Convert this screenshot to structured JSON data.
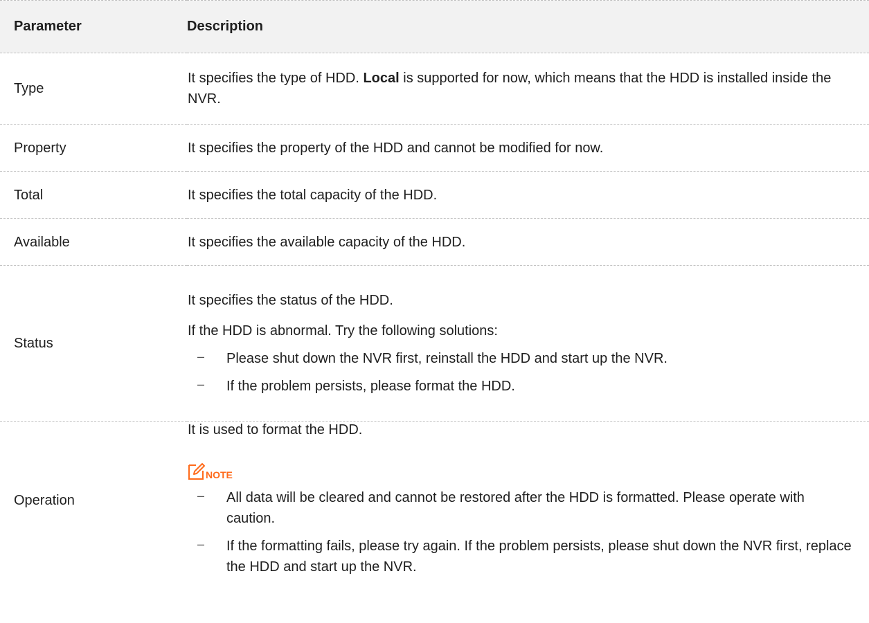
{
  "table": {
    "headers": {
      "parameter": "Parameter",
      "description": "Description"
    },
    "rows": {
      "type": {
        "name": "Type",
        "desc_before": "It specifies the type of HDD. ",
        "desc_bold": "Local",
        "desc_after": " is supported for now, which means that the HDD is installed inside the NVR."
      },
      "property": {
        "name": "Property",
        "desc": "It specifies the property of the HDD and cannot be modified for now."
      },
      "total": {
        "name": "Total",
        "desc": "It specifies the total capacity of the HDD."
      },
      "available": {
        "name": "Available",
        "desc": "It specifies the available capacity of the HDD."
      },
      "status": {
        "name": "Status",
        "desc": "It specifies the status of the HDD.",
        "desc2": "If the HDD is abnormal. Try the following solutions:",
        "bullets": [
          "Please shut down the NVR first, reinstall the HDD and start up the NVR.",
          "If the problem persists, please format the HDD."
        ]
      },
      "operation": {
        "name": "Operation",
        "desc": "It is used to format the HDD.",
        "note_label": "NOTE",
        "bullets": [
          "All data will be cleared and cannot be restored after the HDD is formatted. Please operate with caution.",
          "If the formatting fails, please try again. If the problem persists, please shut down the NVR first, replace the HDD and start up the NVR."
        ]
      }
    }
  },
  "colors": {
    "header_bg": "#f2f2f2",
    "note_accent": "#ff6a1a",
    "border": "#c4c4c4"
  },
  "icons": {
    "note": "note-pencil-icon",
    "bullet": "dash-bullet"
  }
}
